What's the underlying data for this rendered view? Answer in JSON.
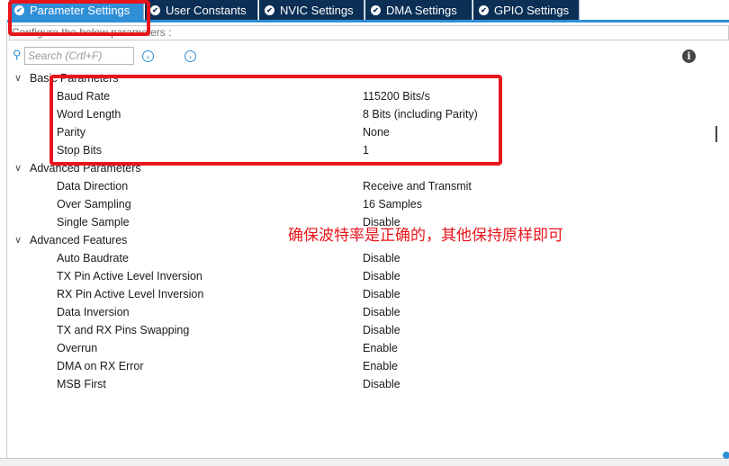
{
  "tabs": [
    {
      "label": "Parameter Settings",
      "active": true
    },
    {
      "label": "User Constants",
      "active": false
    },
    {
      "label": "NVIC Settings",
      "active": false
    },
    {
      "label": "DMA Settings",
      "active": false
    },
    {
      "label": "GPIO Settings",
      "active": false
    }
  ],
  "hint": "Configure the below parameters :",
  "search": {
    "placeholder": "Search (Crtl+F)"
  },
  "groups": [
    {
      "label": "Basic Parameters",
      "params": [
        {
          "name": "Baud Rate",
          "value": "115200 Bits/s"
        },
        {
          "name": "Word Length",
          "value": "8 Bits (including Parity)"
        },
        {
          "name": "Parity",
          "value": "None"
        },
        {
          "name": "Stop Bits",
          "value": "1"
        }
      ]
    },
    {
      "label": "Advanced Parameters",
      "params": [
        {
          "name": "Data Direction",
          "value": "Receive and Transmit"
        },
        {
          "name": "Over Sampling",
          "value": "16 Samples"
        },
        {
          "name": "Single Sample",
          "value": "Disable"
        }
      ]
    },
    {
      "label": "Advanced Features",
      "params": [
        {
          "name": "Auto Baudrate",
          "value": "Disable"
        },
        {
          "name": "TX Pin Active Level Inversion",
          "value": "Disable"
        },
        {
          "name": "RX Pin Active Level Inversion",
          "value": "Disable"
        },
        {
          "name": "Data Inversion",
          "value": "Disable"
        },
        {
          "name": "TX and RX Pins Swapping",
          "value": "Disable"
        },
        {
          "name": "Overrun",
          "value": "Enable"
        },
        {
          "name": "DMA on RX Error",
          "value": "Enable"
        },
        {
          "name": "MSB First",
          "value": "Disable"
        }
      ]
    }
  ],
  "annotation": "确保波特率是正确的，其他保持原样即可",
  "colors": {
    "accent": "#2f8fd6",
    "tab_bg": "#0b2f55",
    "highlight": "#e8141c"
  }
}
